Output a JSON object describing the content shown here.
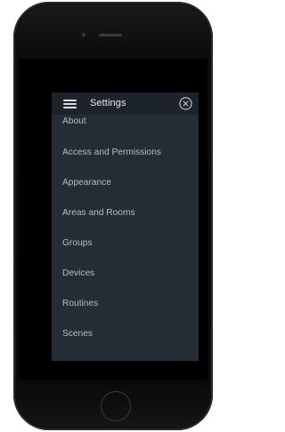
{
  "header": {
    "title": "Settings",
    "menu_icon": "hamburger-icon",
    "close_icon": "close-circle-icon"
  },
  "menu": {
    "items": [
      {
        "label": "About"
      },
      {
        "label": "Access and Permissions"
      },
      {
        "label": "Appearance"
      },
      {
        "label": "Areas and Rooms"
      },
      {
        "label": "Groups"
      },
      {
        "label": "Devices"
      },
      {
        "label": "Routines"
      },
      {
        "label": "Scenes"
      }
    ]
  },
  "colors": {
    "panel_background": "#242d35",
    "header_background": "#1c232a",
    "item_text": "#b4bdc6",
    "title_text": "#e6eaee"
  }
}
